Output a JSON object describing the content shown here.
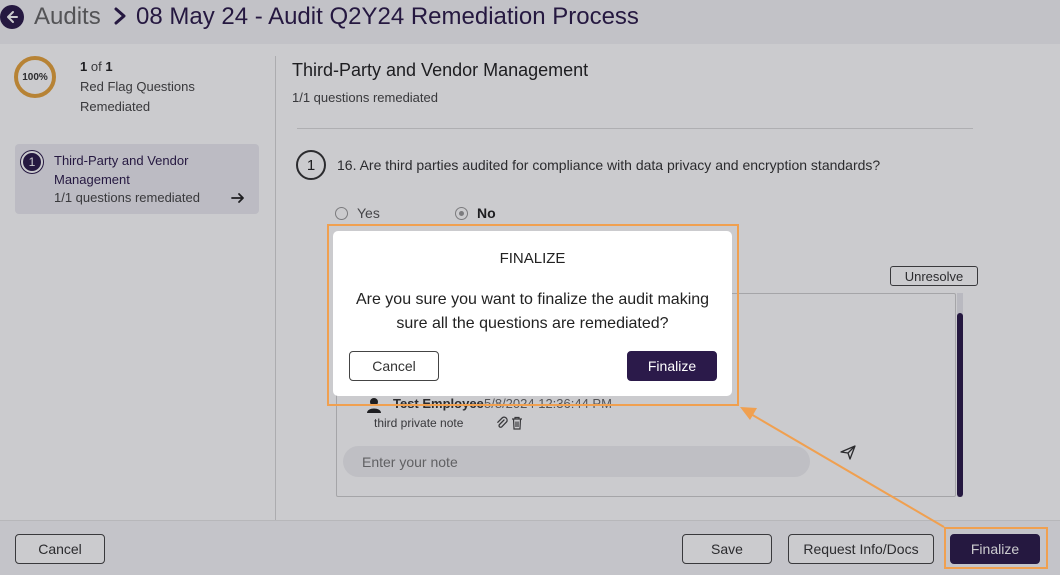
{
  "header": {
    "root_label": "Audits",
    "current_label": "08 May 24 - Audit Q2Y24 Remediation Process"
  },
  "sidebar": {
    "progress_percent": "100%",
    "progress_current": "1",
    "progress_of": "of",
    "progress_total": "1",
    "progress_line2": "Red Flag Questions",
    "progress_line3": "Remediated",
    "section": {
      "number": "1",
      "title": "Third-Party and Vendor Management",
      "subtitle": "1/1 questions remediated"
    }
  },
  "main": {
    "title": "Third-Party and Vendor Management",
    "subtitle": "1/1 questions remediated",
    "question": {
      "number": "1",
      "text": "16. Are third parties audited for compliance with data privacy and encryption standards?",
      "options": [
        "Yes",
        "No"
      ],
      "selected": "No"
    },
    "unresolve_label": "Unresolve",
    "note": {
      "author": "Test Employee",
      "timestamp": "5/8/2024 12:36:44 PM",
      "text": "third private note"
    },
    "note_input_placeholder": "Enter your note"
  },
  "footer": {
    "cancel_label": "Cancel",
    "save_label": "Save",
    "request_label": "Request Info/Docs",
    "finalize_label": "Finalize"
  },
  "modal": {
    "title": "FINALIZE",
    "body": "Are you sure you want to finalize the audit making sure all the questions are remediated?",
    "cancel_label": "Cancel",
    "confirm_label": "Finalize"
  },
  "colors": {
    "brand": "#2b1a4a",
    "progress_ring": "#e6a33c",
    "annotation": "#f0a050"
  }
}
